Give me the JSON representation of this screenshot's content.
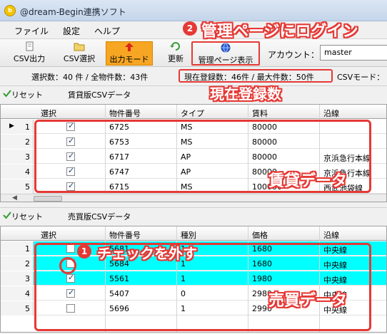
{
  "window": {
    "title": "@dream-Begin連携ソフト",
    "icon": "app-logo-icon"
  },
  "menu": [
    "ファイル",
    "設定",
    "ヘルプ"
  ],
  "toolbar": {
    "csv_out": "CSV出力",
    "csv_select": "CSV選択",
    "output_mode": "出力モード",
    "refresh": "更新",
    "admin_page": "管理ページ表示",
    "account_label": "アカウント：",
    "account_value": "master"
  },
  "status": {
    "selected": "選択数：40 件 / 全物件数：43件",
    "registered": "現在登録数：46件 / 最大件数：50件",
    "csv_mode": "CSVモード："
  },
  "annotations": {
    "step2_num": "2",
    "step2_text": "管理ページにログイン",
    "registered_caption": "現在登録数",
    "rental_caption": "賃貸データ",
    "step1_num": "1",
    "step1_text": "チェックを外す",
    "sale_caption": "売買データ"
  },
  "rental": {
    "reset_label": "リセット",
    "title": "賃貸版CSVデータ",
    "columns": [
      "選択",
      "物件番号",
      "タイプ",
      "賃料",
      "沿線"
    ],
    "rows": [
      {
        "num": "1",
        "checked": true,
        "id": "6725",
        "type": "MS",
        "price": "80000",
        "line": ""
      },
      {
        "num": "2",
        "checked": true,
        "id": "6753",
        "type": "MS",
        "price": "80000",
        "line": ""
      },
      {
        "num": "3",
        "checked": true,
        "id": "6717",
        "type": "AP",
        "price": "80000",
        "line": "京浜急行本線"
      },
      {
        "num": "4",
        "checked": true,
        "id": "6747",
        "type": "AP",
        "price": "80000",
        "line": "京浜急行本線"
      },
      {
        "num": "5",
        "checked": true,
        "id": "6715",
        "type": "MS",
        "price": "100000",
        "line": "西武池袋線"
      }
    ]
  },
  "sale": {
    "reset_label": "リセット",
    "title": "売買版CSVデータ",
    "columns": [
      "選択",
      "物件番号",
      "種別",
      "価格",
      "沿線"
    ],
    "rows": [
      {
        "num": "1",
        "checked": false,
        "id": "5681",
        "type": "1",
        "price": "1680",
        "line": "中央線",
        "highlight": true
      },
      {
        "num": "2",
        "checked": false,
        "id": "5684",
        "type": "1",
        "price": "1680",
        "line": "中央線",
        "highlight": true
      },
      {
        "num": "3",
        "checked": true,
        "id": "5561",
        "type": "1",
        "price": "1980",
        "line": "中央線",
        "highlight": true
      },
      {
        "num": "4",
        "checked": true,
        "id": "5407",
        "type": "0",
        "price": "2980",
        "line": "中央線",
        "highlight": false
      },
      {
        "num": "5",
        "checked": false,
        "id": "5696",
        "type": "1",
        "price": "2990",
        "line": "中央線",
        "highlight": false
      }
    ]
  },
  "colors": {
    "accent_red": "#e53935",
    "highlight_row": "#00ffff",
    "active_button": "#f6a623"
  }
}
